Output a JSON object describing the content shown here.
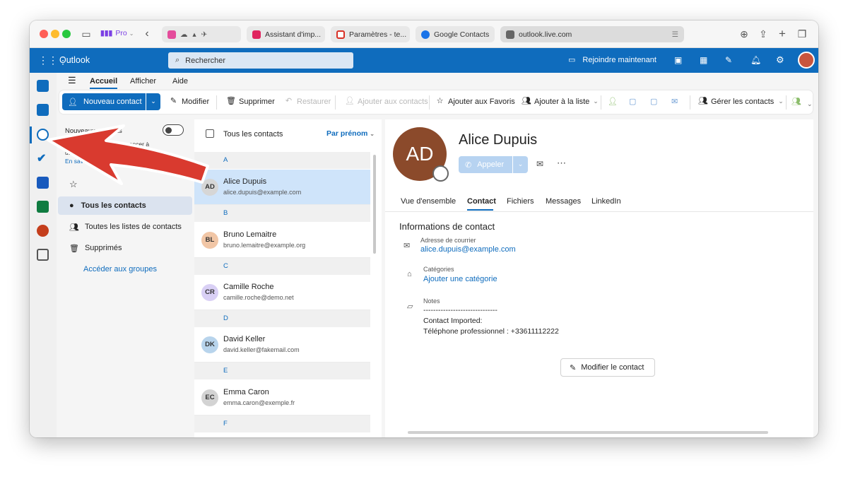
{
  "browser": {
    "profile_label": "Pro",
    "tabs": [
      {
        "label": "Assistant d'imp...",
        "icon": "assistant-icon",
        "color": "#e0245e"
      },
      {
        "label": "Paramètres - te...",
        "icon": "gmail-icon",
        "color": "#d93025"
      },
      {
        "label": "Google Contacts",
        "icon": "google-contacts-icon",
        "color": "#1a73e8"
      }
    ],
    "address": "outlook.live.com"
  },
  "outlook": {
    "app_name": "Outlook",
    "search_placeholder": "Rechercher",
    "join_now": "Rejoindre maintenant",
    "brand_color": "#0f6cbd"
  },
  "menu": {
    "home": "Accueil",
    "view": "Afficher",
    "help": "Aide"
  },
  "ribbon": {
    "new_contact": "Nouveau contact",
    "edit": "Modifier",
    "delete": "Supprimer",
    "restore": "Restaurer",
    "add_to_contacts": "Ajouter aux contacts",
    "add_to_favorites": "Ajouter aux Favoris",
    "add_to_list": "Ajouter à la liste",
    "manage_contacts": "Gérer les contacts"
  },
  "folders": {
    "new_contacts_toggle": "Nouveaux contacts",
    "toggle_desc_line1": "Cette option pour commencer à",
    "toggle_desc_line2": "utiliser les nouvelles fonctionnalités",
    "learn_more": "En savoir plus",
    "all_contacts": "Tous les contacts",
    "all_lists": "Toutes les listes de contacts",
    "deleted": "Supprimés",
    "groups": "Accéder aux groupes"
  },
  "list": {
    "header": "Tous les contacts",
    "sort": "Par prénom",
    "sections": [
      "A",
      "B",
      "C",
      "D",
      "E",
      "F"
    ],
    "contacts": [
      {
        "initials": "AD",
        "name": "Alice Dupuis",
        "email": "alice.dupuis@example.com",
        "avatar_color": "#d6d6d6",
        "selected": true
      },
      {
        "initials": "BL",
        "name": "Bruno Lemaitre",
        "email": "bruno.lemaitre@example.org",
        "avatar_color": "#f1c6a6",
        "selected": false
      },
      {
        "initials": "CR",
        "name": "Camille Roche",
        "email": "camille.roche@demo.net",
        "avatar_color": "#d9d0f5",
        "selected": false
      },
      {
        "initials": "DK",
        "name": "David Keller",
        "email": "david.keller@fakemail.com",
        "avatar_color": "#b8d4ec",
        "selected": false
      },
      {
        "initials": "EC",
        "name": "Emma Caron",
        "email": "emma.caron@exemple.fr",
        "avatar_color": "#d3d3d3",
        "selected": false
      }
    ]
  },
  "detail": {
    "initials": "AD",
    "name": "Alice Dupuis",
    "avatar_color": "#8b4a2b",
    "call": "Appeler",
    "tabs": [
      "Vue d'ensemble",
      "Contact",
      "Fichiers",
      "Messages",
      "LinkedIn"
    ],
    "active_tab": "Contact",
    "section_title": "Informations de contact",
    "email_label": "Adresse de courrier",
    "email_value": "alice.dupuis@example.com",
    "categories_label": "Catégories",
    "categories_value": "Ajouter une catégorie",
    "notes_label": "Notes",
    "notes_line1": "------------------------------",
    "notes_line2": "Contact Imported:",
    "notes_line3": "Téléphone professionnel : +33611112222",
    "edit_contact": "Modifier le contact"
  },
  "annotation": {
    "arrow_color": "#d93a2f"
  }
}
